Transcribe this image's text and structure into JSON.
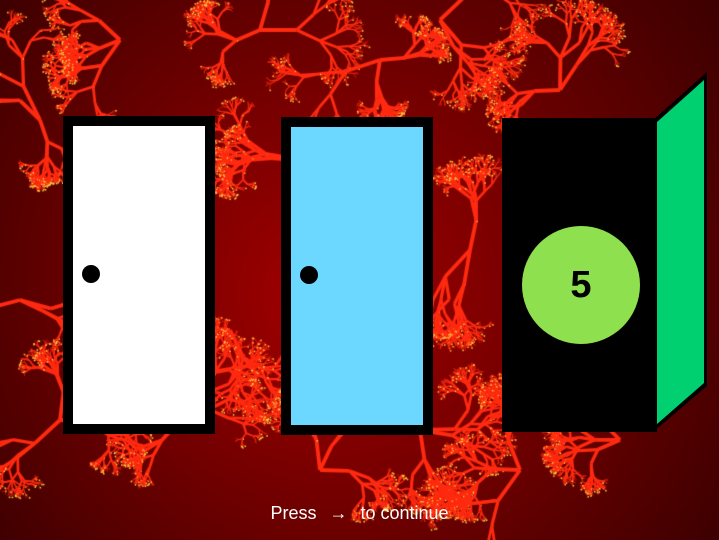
{
  "scene": {
    "background_colors": {
      "dark": "#2a0000",
      "mid": "#9a0000",
      "fractal": "#ff2a10",
      "spark": "#ffd040"
    }
  },
  "doors": [
    {
      "state": "closed",
      "color": "#ffffff",
      "frame_color": "#000000",
      "has_knob": true
    },
    {
      "state": "closed",
      "color": "#6dd8ff",
      "frame_color": "#000000",
      "has_knob": true
    },
    {
      "state": "open",
      "color": "#00d070",
      "frame_color": "#000000",
      "prize": {
        "value": "5",
        "color": "#8ee04e"
      }
    }
  ],
  "instruction": {
    "prefix": "Press",
    "key_icon": "right-arrow-icon",
    "key_glyph": "→",
    "suffix": "to continue"
  }
}
